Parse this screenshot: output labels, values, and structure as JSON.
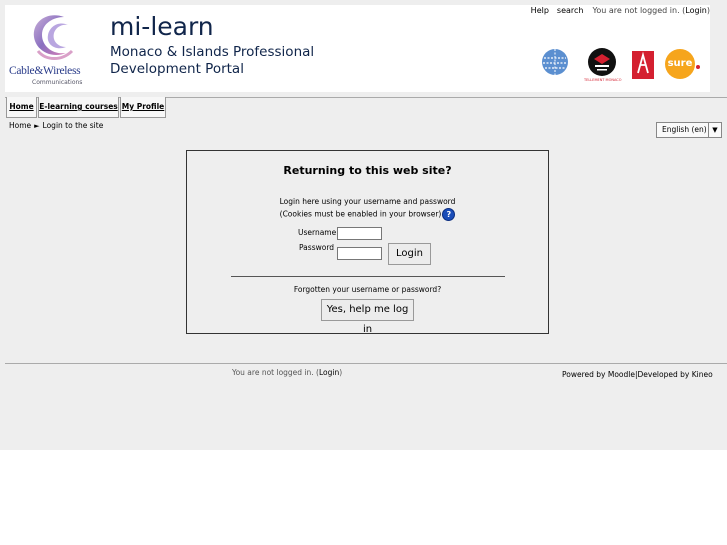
{
  "header": {
    "brand_name": "Cable&Wireless",
    "brand_sub": "Communications",
    "title": "mi-learn",
    "subtitle_line1": "Monaco & Islands Professional",
    "subtitle_line2": "Development Portal",
    "help_link": "Help",
    "search_link": "search",
    "logged_text": "You are not logged in. (",
    "login_link": "Login",
    "logged_close": ")",
    "partner_logo_small_text": "TELLEMENT MONACO",
    "partner_logo_sure_text": "sure"
  },
  "nav": {
    "items": [
      {
        "label": "Home"
      },
      {
        "label": "E-learning courses"
      },
      {
        "label": "My Profile"
      }
    ]
  },
  "breadcrumb": {
    "home": "Home",
    "separator": "►",
    "current": "Login to the site"
  },
  "language": {
    "selected": "English (en)",
    "arrow": "▼"
  },
  "login": {
    "heading": "Returning to this web site?",
    "intro_line1": "Login here using your username and password",
    "intro_line2": "(Cookies must be enabled in your browser)",
    "help_icon_glyph": "?",
    "username_label": "Username",
    "password_label": "Password",
    "username_value": "",
    "password_value": "",
    "login_button": "Login",
    "forgot_text": "Forgotten your username or password?",
    "help_button": "Yes, help me log in"
  },
  "footer": {
    "logged_text": "You are not logged in. (",
    "login_link": "Login",
    "logged_close": ")",
    "powered_by": "Powered by Moodle|Developed by Kineo"
  },
  "colors": {
    "page_bg": "#eeeeee",
    "title": "#10254a",
    "brand_blue": "#2a3c8a",
    "sure_orange": "#f6a51c",
    "red_logo": "#d42030",
    "help_icon": "#1b4db8"
  }
}
